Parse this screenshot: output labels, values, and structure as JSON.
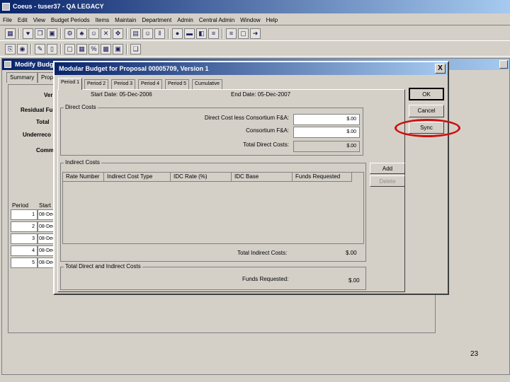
{
  "app": {
    "title": "Coeus - tuser37 - QA LEGACY"
  },
  "menu": [
    "File",
    "Edit",
    "View",
    "Budget Periods",
    "Items",
    "Maintain",
    "Department",
    "Admin",
    "Central Admin",
    "Window",
    "Help"
  ],
  "toolbar1_icons": [
    "table-icon",
    "heart-icon",
    "copy-icon",
    "floppy-icon",
    "gear-icon",
    "tree-icon",
    "person-icon",
    "cross-icon",
    "move-icon",
    "folder-icon",
    "person-icon",
    "columns-icon",
    "stop-icon",
    "printer-icon",
    "view-icon",
    "list-icon",
    "list-icon",
    "window-icon",
    "exit-icon"
  ],
  "toolbar2_icons": [
    "link-icon",
    "globe-icon",
    "edit-icon",
    "document-icon",
    "window-icon",
    "calendar-icon",
    "percent-icon",
    "grid-icon",
    "floppy-icon",
    "page-icon"
  ],
  "background_window": {
    "title": "Modify Budg",
    "tabs": [
      "Summary",
      "Prop"
    ],
    "labels": [
      "Ver",
      "Residual Fu",
      "Total",
      "Underreco",
      "Comm"
    ],
    "period_header": "Period",
    "start_header": "Start",
    "periods": [
      "1",
      "2",
      "3",
      "4",
      "5"
    ],
    "period_start_stub": "08-Dec"
  },
  "dialog": {
    "title": "Modular Budget for Proposal 00005709, Version 1",
    "close": "X",
    "tabs": [
      "Period 1",
      "Period 2",
      "Period 3",
      "Period 4",
      "Period 5",
      "Cumulative"
    ],
    "start_date": "Start Date: 05-Dec-2006",
    "end_date": "End Date: 05-Dec-2007",
    "direct_costs": {
      "legend": "Direct Costs",
      "dc_less_consortium_label": "Direct Cost less Consortium F&A:",
      "dc_less_consortium_value": "$.00",
      "consortium_label": "Consortium F&A:",
      "consortium_value": "$.00",
      "total_direct_label": "Total Direct Costs:",
      "total_direct_value": "$.00"
    },
    "indirect_costs": {
      "legend": "Indirect Costs",
      "columns": [
        "Rate Number",
        "Indirect Cost Type",
        "IDC Rate (%)",
        "IDC Base",
        "Funds Requested"
      ],
      "total_label": "Total Indirect Costs:",
      "total_value": "$.00"
    },
    "totals": {
      "legend": "Total Direct and Indirect Costs",
      "funds_requested_label": "Funds Requested:",
      "funds_requested_value": "$.00"
    },
    "buttons": {
      "ok": "OK",
      "cancel": "Cancel",
      "sync": "Sync",
      "add": "Add",
      "delete": "Delete"
    }
  },
  "highlight": {
    "color": "#cc1111"
  },
  "page_number": "23"
}
